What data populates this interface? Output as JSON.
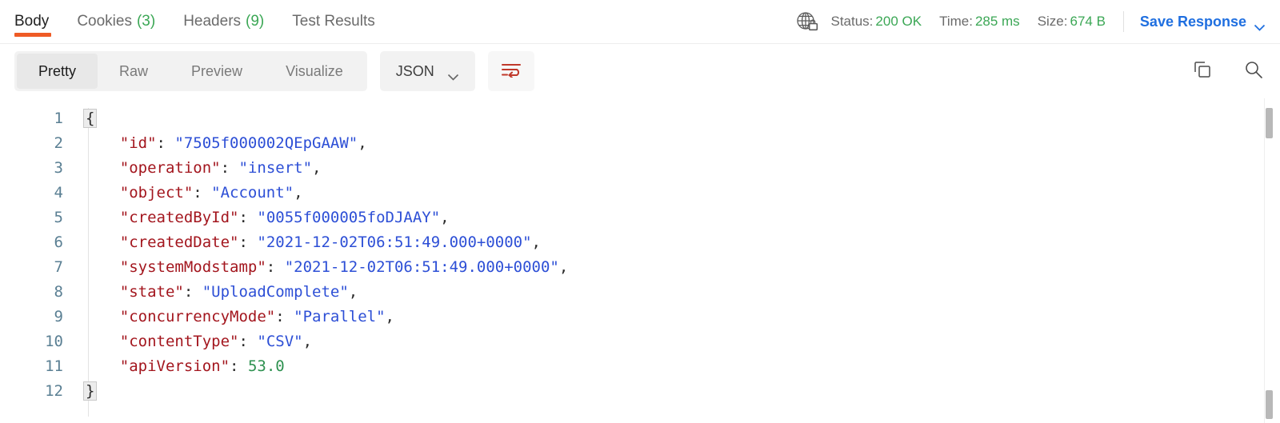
{
  "tabs": [
    {
      "label": "Body",
      "count": null,
      "active": true
    },
    {
      "label": "Cookies",
      "count": "(3)",
      "active": false
    },
    {
      "label": "Headers",
      "count": "(9)",
      "active": false
    },
    {
      "label": "Test Results",
      "count": null,
      "active": false
    }
  ],
  "meta": {
    "globe_icon": "globe-lock-icon",
    "status_label": "Status:",
    "status_value": "200 OK",
    "time_label": "Time:",
    "time_value": "285 ms",
    "size_label": "Size:",
    "size_value": "674 B",
    "save_response_label": "Save Response"
  },
  "toolbar": {
    "view_modes": [
      {
        "label": "Pretty",
        "active": true
      },
      {
        "label": "Raw",
        "active": false
      },
      {
        "label": "Preview",
        "active": false
      },
      {
        "label": "Visualize",
        "active": false
      }
    ],
    "format_label": "JSON",
    "wrap_icon": "word-wrap-icon",
    "copy_icon": "copy-icon",
    "search_icon": "search-icon"
  },
  "code": {
    "language": "json",
    "lines": [
      {
        "num": "1",
        "segments": [
          {
            "t": "{",
            "c": "brace-hl"
          }
        ]
      },
      {
        "num": "2",
        "segments": [
          {
            "t": "    ",
            "c": "tok-punct"
          },
          {
            "t": "\"id\"",
            "c": "tok-key"
          },
          {
            "t": ": ",
            "c": "tok-punct"
          },
          {
            "t": "\"7505f000002QEpGAAW\"",
            "c": "tok-str"
          },
          {
            "t": ",",
            "c": "tok-punct"
          }
        ]
      },
      {
        "num": "3",
        "segments": [
          {
            "t": "    ",
            "c": "tok-punct"
          },
          {
            "t": "\"operation\"",
            "c": "tok-key"
          },
          {
            "t": ": ",
            "c": "tok-punct"
          },
          {
            "t": "\"insert\"",
            "c": "tok-str"
          },
          {
            "t": ",",
            "c": "tok-punct"
          }
        ]
      },
      {
        "num": "4",
        "segments": [
          {
            "t": "    ",
            "c": "tok-punct"
          },
          {
            "t": "\"object\"",
            "c": "tok-key"
          },
          {
            "t": ": ",
            "c": "tok-punct"
          },
          {
            "t": "\"Account\"",
            "c": "tok-str"
          },
          {
            "t": ",",
            "c": "tok-punct"
          }
        ]
      },
      {
        "num": "5",
        "segments": [
          {
            "t": "    ",
            "c": "tok-punct"
          },
          {
            "t": "\"createdById\"",
            "c": "tok-key"
          },
          {
            "t": ": ",
            "c": "tok-punct"
          },
          {
            "t": "\"0055f000005foDJAAY\"",
            "c": "tok-str"
          },
          {
            "t": ",",
            "c": "tok-punct"
          }
        ]
      },
      {
        "num": "6",
        "segments": [
          {
            "t": "    ",
            "c": "tok-punct"
          },
          {
            "t": "\"createdDate\"",
            "c": "tok-key"
          },
          {
            "t": ": ",
            "c": "tok-punct"
          },
          {
            "t": "\"2021-12-02T06:51:49.000+0000\"",
            "c": "tok-str"
          },
          {
            "t": ",",
            "c": "tok-punct"
          }
        ]
      },
      {
        "num": "7",
        "segments": [
          {
            "t": "    ",
            "c": "tok-punct"
          },
          {
            "t": "\"systemModstamp\"",
            "c": "tok-key"
          },
          {
            "t": ": ",
            "c": "tok-punct"
          },
          {
            "t": "\"2021-12-02T06:51:49.000+0000\"",
            "c": "tok-str"
          },
          {
            "t": ",",
            "c": "tok-punct"
          }
        ]
      },
      {
        "num": "8",
        "segments": [
          {
            "t": "    ",
            "c": "tok-punct"
          },
          {
            "t": "\"state\"",
            "c": "tok-key"
          },
          {
            "t": ": ",
            "c": "tok-punct"
          },
          {
            "t": "\"UploadComplete\"",
            "c": "tok-str"
          },
          {
            "t": ",",
            "c": "tok-punct"
          }
        ]
      },
      {
        "num": "9",
        "segments": [
          {
            "t": "    ",
            "c": "tok-punct"
          },
          {
            "t": "\"concurrencyMode\"",
            "c": "tok-key"
          },
          {
            "t": ": ",
            "c": "tok-punct"
          },
          {
            "t": "\"Parallel\"",
            "c": "tok-str"
          },
          {
            "t": ",",
            "c": "tok-punct"
          }
        ]
      },
      {
        "num": "10",
        "segments": [
          {
            "t": "    ",
            "c": "tok-punct"
          },
          {
            "t": "\"contentType\"",
            "c": "tok-key"
          },
          {
            "t": ": ",
            "c": "tok-punct"
          },
          {
            "t": "\"CSV\"",
            "c": "tok-str"
          },
          {
            "t": ",",
            "c": "tok-punct"
          }
        ]
      },
      {
        "num": "11",
        "segments": [
          {
            "t": "    ",
            "c": "tok-punct"
          },
          {
            "t": "\"apiVersion\"",
            "c": "tok-key"
          },
          {
            "t": ": ",
            "c": "tok-punct"
          },
          {
            "t": "53.0",
            "c": "tok-num"
          }
        ]
      },
      {
        "num": "12",
        "segments": [
          {
            "t": "}",
            "c": "brace-hl"
          }
        ]
      }
    ]
  },
  "colors": {
    "accent_orange": "#ef5b25",
    "success_green": "#3ba755",
    "link_blue": "#1f6fe0",
    "json_key": "#a3161e",
    "json_string": "#2d4fd6",
    "json_number": "#2e9150",
    "line_number": "#5a7f93",
    "wrap_icon_red": "#c0392b"
  }
}
